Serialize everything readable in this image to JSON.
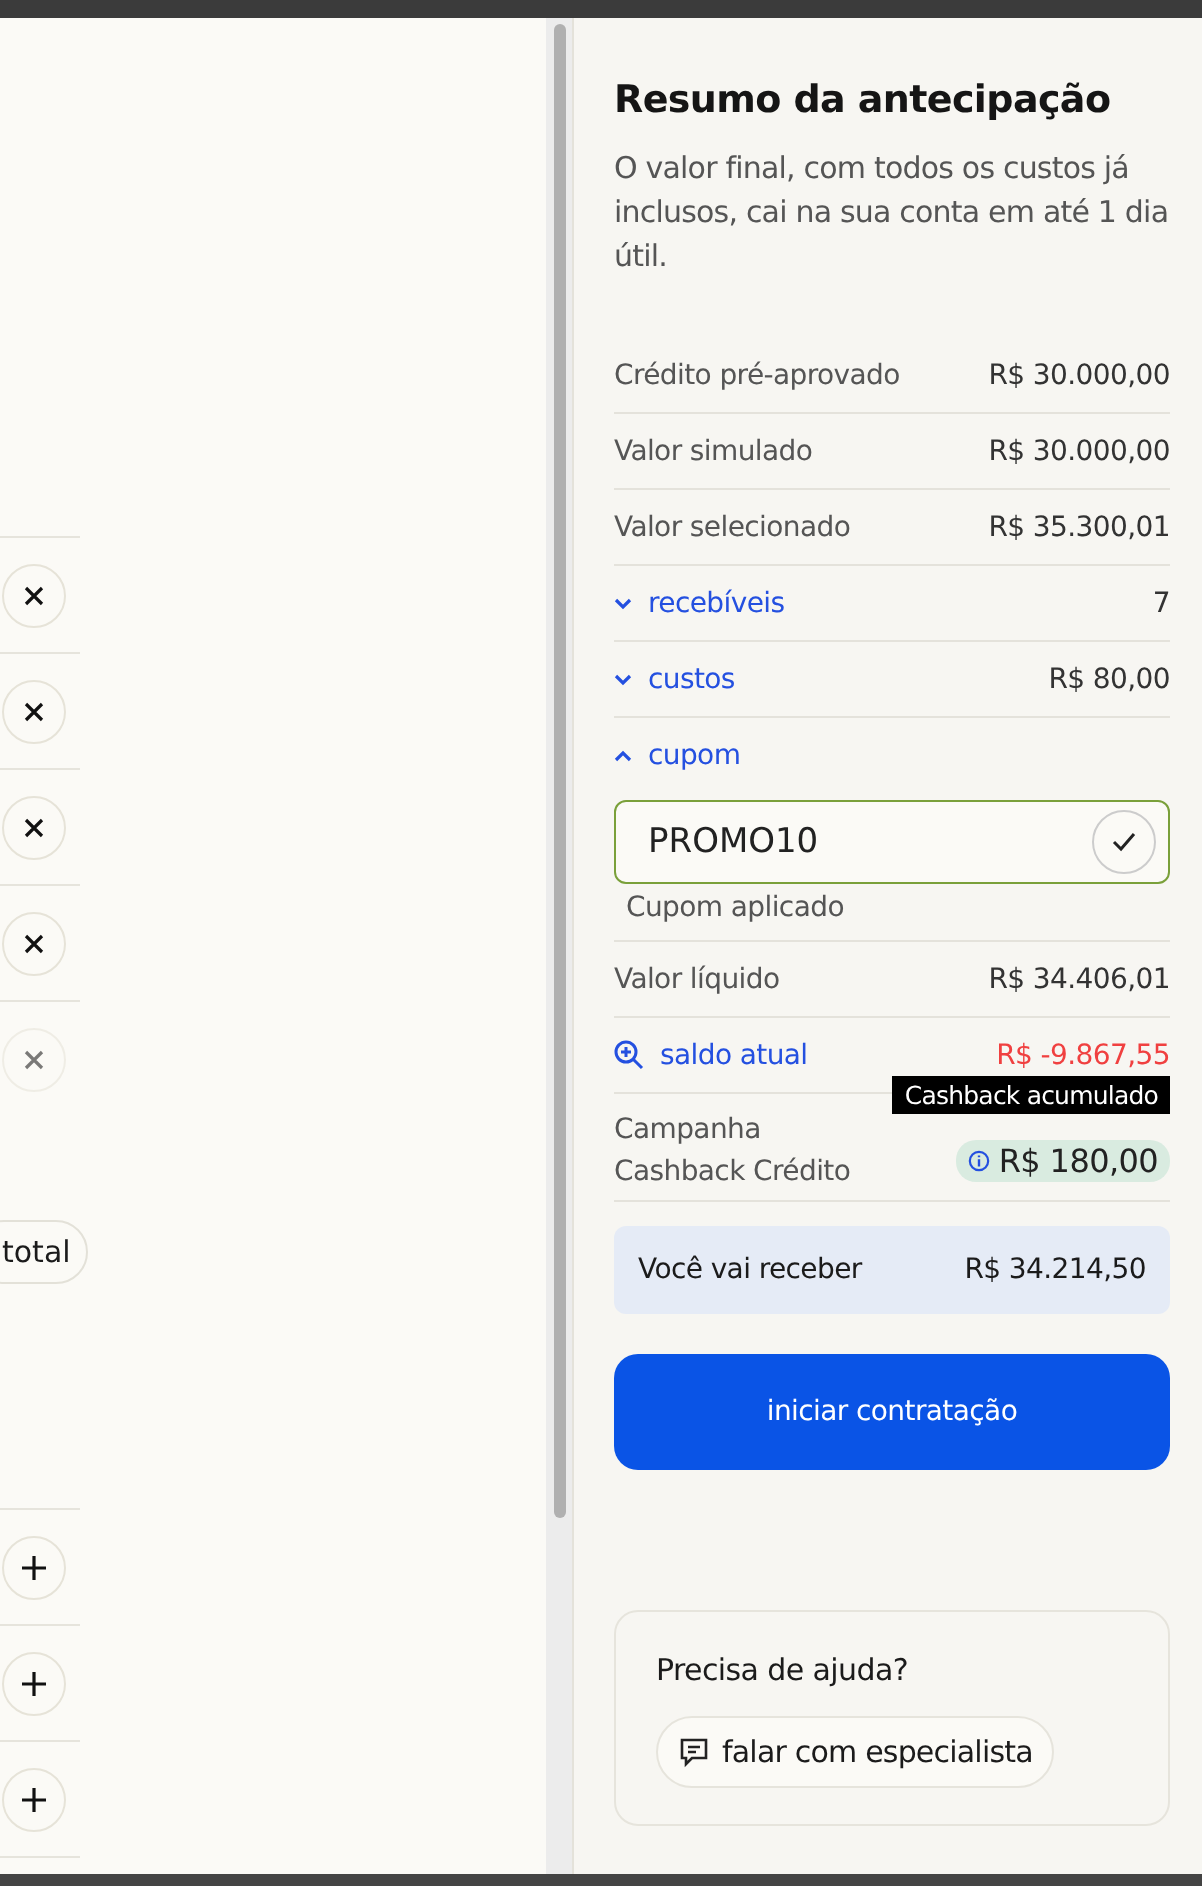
{
  "left_panel": {
    "remove_buttons": [
      {
        "disabled": false
      },
      {
        "disabled": false
      },
      {
        "disabled": false
      },
      {
        "disabled": false
      },
      {
        "disabled": true
      }
    ],
    "total_chip": "total",
    "add_buttons": [
      {
        "disabled": false
      },
      {
        "disabled": false
      },
      {
        "disabled": false
      }
    ]
  },
  "summary": {
    "title": "Resumo da antecipação",
    "description": "O valor final, com todos os custos já inclusos, cai na sua conta em até 1 dia útil.",
    "rows": [
      {
        "kind": "plain",
        "label": "Crédito pré-aprovado",
        "value": "R$ 30.000,00"
      },
      {
        "kind": "plain",
        "label": "Valor simulado",
        "value": "R$ 30.000,00"
      },
      {
        "kind": "plain",
        "label": "Valor selecionado",
        "value": "R$ 35.300,01"
      },
      {
        "kind": "toggle",
        "label": "recebíveis",
        "value": "7",
        "expanded": false
      },
      {
        "kind": "toggle",
        "label": "custos",
        "value": "R$ 80,00",
        "expanded": false
      },
      {
        "kind": "toggle",
        "label": "cupom",
        "expanded": true,
        "coupon": {
          "value": "PROMO10",
          "status": "Cupom aplicado",
          "applied": true
        }
      },
      {
        "kind": "plain",
        "label": "Valor líquido",
        "value": "R$ 34.406,01"
      },
      {
        "kind": "link",
        "label": "saldo atual",
        "value": "R$ -9.867,55",
        "negative": true
      },
      {
        "kind": "badge",
        "label": "Campanha Cashback Crédito",
        "value": "R$ 180,00",
        "tooltip": "Cashback acumulado"
      }
    ],
    "total": {
      "label": "Você vai receber",
      "value": "R$ 34.214,50"
    },
    "action": "iniciar contratação"
  },
  "help": {
    "title": "Precisa de ajuda?",
    "button": "falar com especialista"
  }
}
